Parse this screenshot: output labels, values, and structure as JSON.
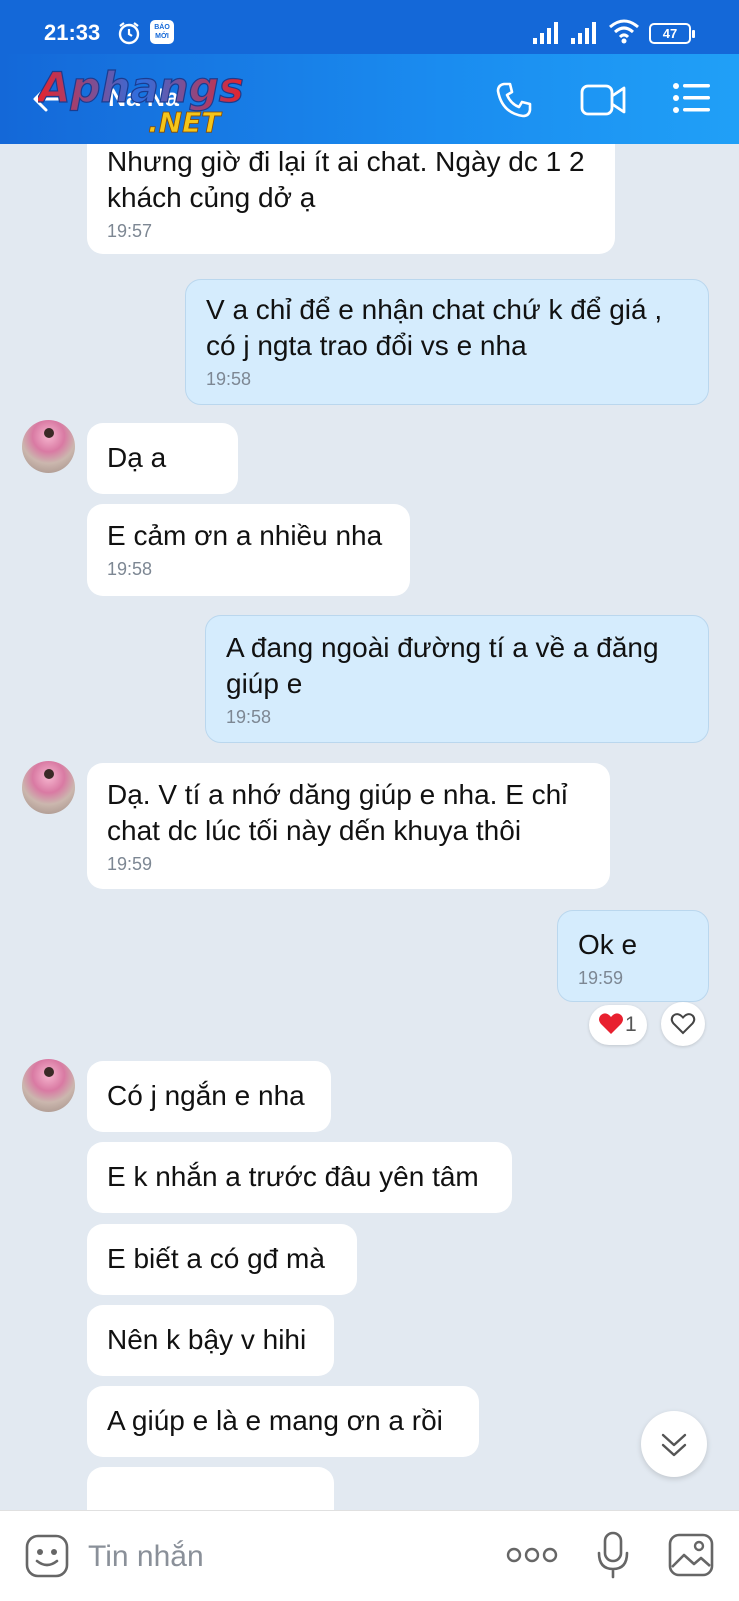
{
  "status_bar": {
    "time": "21:33",
    "battery": "47",
    "app_badge": "BÁO MỚI"
  },
  "header": {
    "contact_name": "Na Na",
    "logo_main": "Aphangs",
    "logo_sub": ".NET"
  },
  "messages": [
    {
      "dir": "in",
      "text": "Nhưng giờ đi lại ít ai chat. Ngày dc 1 2 khách củng dở ạ",
      "time": "19:57"
    },
    {
      "dir": "out",
      "text": "V a chỉ để e nhận chat chứ k để giá , có j ngta trao đổi vs e nha",
      "time": "19:58"
    },
    {
      "dir": "in",
      "text": "Dạ a",
      "time": ""
    },
    {
      "dir": "in",
      "text": "E cảm ơn a nhiều nha",
      "time": "19:58"
    },
    {
      "dir": "out",
      "text": "A đang ngoài đường tí a về a đăng giúp e",
      "time": "19:58"
    },
    {
      "dir": "in",
      "text": "Dạ. V tí a nhớ dăng giúp e nha. E chỉ chat dc lúc tối này dến khuya thôi",
      "time": "19:59"
    },
    {
      "dir": "out",
      "text": "Ok e",
      "time": "19:59"
    },
    {
      "dir": "in",
      "text": "Có j ngắn e nha",
      "time": ""
    },
    {
      "dir": "in",
      "text": "E k nhắn a trước đâu yên tâm",
      "time": ""
    },
    {
      "dir": "in",
      "text": "E biết a có gđ mà",
      "time": ""
    },
    {
      "dir": "in",
      "text": "Nên k bậy v hihi",
      "time": ""
    },
    {
      "dir": "in",
      "text": "A giúp e là e mang ơn a rồi",
      "time": ""
    }
  ],
  "reaction": {
    "count": "1",
    "icon": "red-heart"
  },
  "input_bar": {
    "placeholder": "Tin nhắn"
  },
  "colors": {
    "header_blue": "#1468d8",
    "outgoing_bubble": "#d5ecfd",
    "incoming_bubble": "#ffffff",
    "chat_background": "#e2e9f1"
  }
}
